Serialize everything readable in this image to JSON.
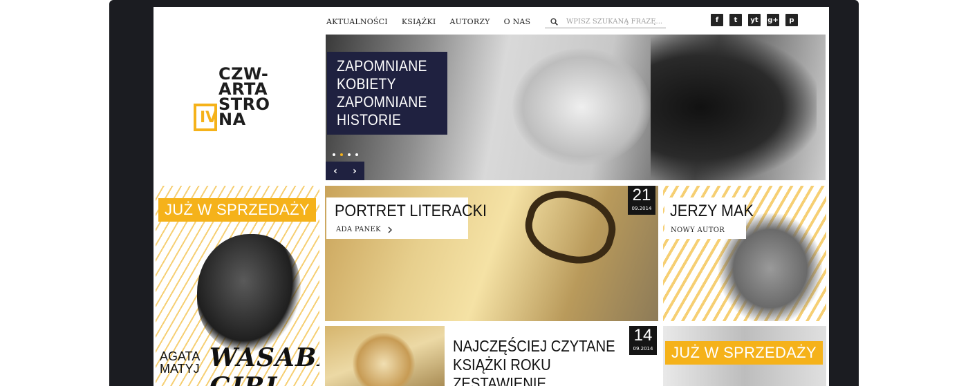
{
  "nav": {
    "items": [
      "AKTUALNOŚCI",
      "KSIĄŻKI",
      "AUTORZY",
      "O NAS"
    ],
    "search_placeholder": "WPISZ SZUKANĄ FRAZĘ..."
  },
  "social": [
    "f",
    "t",
    "yt",
    "g+",
    "p"
  ],
  "logo": {
    "lines": [
      "CZW-",
      "ARTA",
      "STRO",
      "NA"
    ],
    "mark": "IV"
  },
  "hero": {
    "title_lines": [
      "ZAPOMNIANE",
      "KOBIETY",
      "ZAPOMNIANE",
      "HISTORIE"
    ],
    "slide_dots": 4,
    "active_dot": 1,
    "prev_label": "‹",
    "next_label": "›"
  },
  "tile_left": {
    "badge": "JUŻ W SPRZEDAŻY",
    "author_line1": "AGATA",
    "author_line2": "MATYJ",
    "book_title": "WASABI GIRL"
  },
  "tile_mid": {
    "title": "PORTRET LITERACKI",
    "subtitle": "ADA PANEK",
    "day": "21",
    "month": "09.2014"
  },
  "tile_right": {
    "title": "JERZY MAK",
    "subtitle": "NOWY AUTOR"
  },
  "tile_bottom": {
    "title_line1": "NAJCZĘŚCIEJ CZYTANE",
    "title_line2": "KSIĄŻKI ROKU",
    "title_line3": "ZESTAWIENIE",
    "day": "14",
    "month": "09.2014"
  },
  "tile_bottom_right": {
    "badge": "JUŻ W SPRZEDAŻY"
  },
  "colors": {
    "accent": "#f5b21a",
    "navy": "#1f2140",
    "dark": "#151515"
  }
}
